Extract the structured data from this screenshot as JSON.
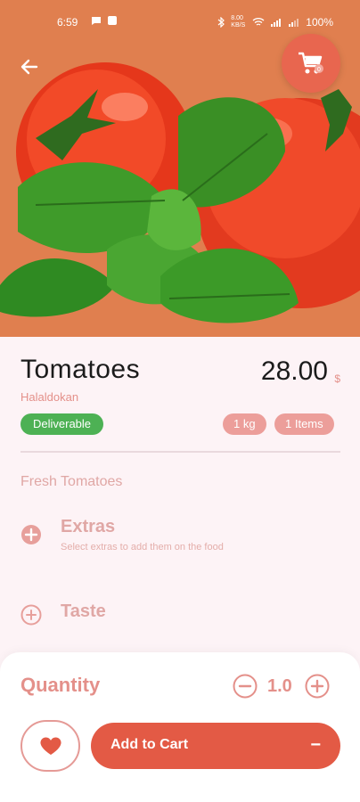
{
  "status_bar": {
    "time": "6:59",
    "speed": "8.00 KB/S",
    "battery": "100%"
  },
  "hero": {
    "background_color": "#e07f4f",
    "image_subject": "tomatoes with basil leaves",
    "back_icon": "arrow-left-icon",
    "cart_icon": "shopping-cart-icon"
  },
  "product": {
    "name": "Tomatoes",
    "seller": "Halaldokan",
    "price": "28.00",
    "currency": "$",
    "deliverable_label": "Deliverable",
    "unit_label": "1 kg",
    "items_label": "1 Items",
    "description": "Fresh Tomatoes"
  },
  "options": {
    "extras": {
      "title": "Extras",
      "subtitle": "Select extras to add them on the food",
      "icon": "plus-circle-filled-icon"
    },
    "taste": {
      "title": "Taste",
      "icon": "plus-circle-outline-icon"
    }
  },
  "cart_sheet": {
    "quantity_label": "Quantity",
    "quantity_value": "1.0",
    "add_to_cart_label": "Add to Cart",
    "add_to_cart_minus": "−",
    "favorite_icon": "heart-icon"
  },
  "colors": {
    "accent": "#e35a45",
    "deliverable_green": "#4db154",
    "pill_pink": "#ec9e9a",
    "page_bg": "#fdf3f6"
  }
}
